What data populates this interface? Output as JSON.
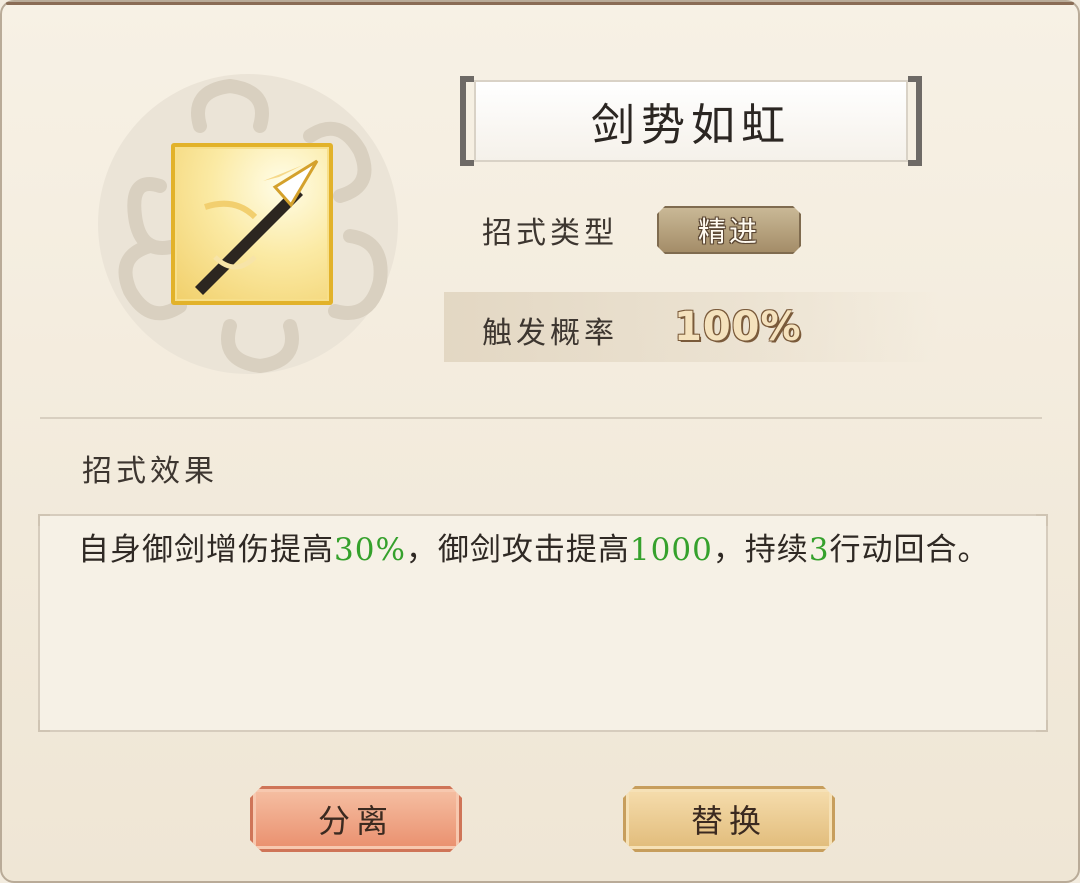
{
  "skill": {
    "name": "剑势如虹",
    "icon": "arrow-spear-icon",
    "type_label": "招式类型",
    "type_value": "精进",
    "probability_label": "触发概率",
    "probability_value": "100%"
  },
  "effect": {
    "section_label": "招式效果",
    "parts": [
      {
        "text": "自身御剑增伤提高",
        "highlight": false
      },
      {
        "text": "30%",
        "highlight": true
      },
      {
        "text": "，御剑攻击提高",
        "highlight": false
      },
      {
        "text": "1000",
        "highlight": true
      },
      {
        "text": "，持续",
        "highlight": false
      },
      {
        "text": "3",
        "highlight": true
      },
      {
        "text": "行动回合。",
        "highlight": false
      }
    ]
  },
  "actions": {
    "split_label": "分离",
    "replace_label": "替换"
  },
  "colors": {
    "highlight": "#35a12c",
    "icon_border": "#e2b22a",
    "split_button": "#e98d6b",
    "replace_button": "#e0ba78"
  }
}
